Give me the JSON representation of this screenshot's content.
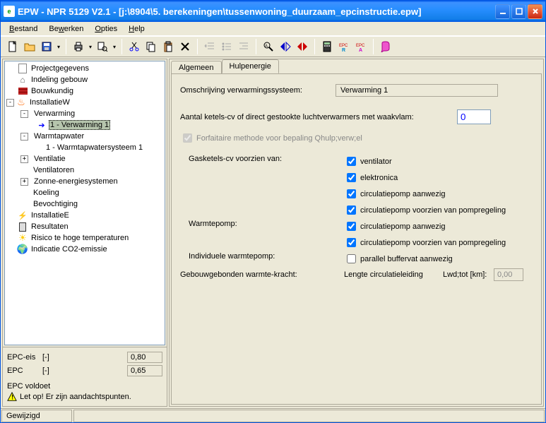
{
  "title": "EPW - NPR 5129 V2.1 - [j:\\8904\\5. berekeningen\\tussenwoning_duurzaam_epcinstructie.epw]",
  "menus": {
    "bestand": "Bestand",
    "bewerken": "Bewerken",
    "opties": "Opties",
    "help": "Help"
  },
  "tree": {
    "projectgegevens": "Projectgegevens",
    "indeling": "Indeling gebouw",
    "bouwkundig": "Bouwkundig",
    "installatiew": "InstallatieW",
    "verwarming": "Verwarming",
    "verwarming1": "1 - Verwarming 1",
    "warmtapwater": "Warmtapwater",
    "warmtap1": "1 - Warmtapwatersysteem 1",
    "ventilatie": "Ventilatie",
    "ventilatoren": "Ventilatoren",
    "zonne": "Zonne-energiesystemen",
    "koeling": "Koeling",
    "bevochtiging": "Bevochtiging",
    "installatiee": "InstallatieE",
    "resultaten": "Resultaten",
    "risico": "Risico te hoge temperaturen",
    "co2": "Indicatie CO2-emissie"
  },
  "bottom": {
    "epc_eis_label": "EPC-eis",
    "epc_eis_unit": "[-]",
    "epc_eis_val": "0,80",
    "epc_label": "EPC",
    "epc_unit": "[-]",
    "epc_val": "0,65",
    "status": "EPC voldoet",
    "warn": "Let op! Er zijn aandachtspunten."
  },
  "tabs": {
    "algemeen": "Algemeen",
    "hulpenergie": "Hulpenergie"
  },
  "form": {
    "omschrijving_label": "Omschrijving verwarmingssysteem:",
    "omschrijving_val": "Verwarming 1",
    "aantal_label": "Aantal ketels-cv of direct gestookte luchtverwarmers met waakvlam:",
    "aantal_val": "0",
    "forfaitaire": "Forfaitaire methode voor bepaling Qhulp;verw;el",
    "gasketels_label": "Gasketels-cv voorzien van:",
    "ventilator": "ventilator",
    "elektronica": "elektronica",
    "circ1": "circulatiepomp aanwezig",
    "circ2": "circulatiepomp voorzien van pompregeling",
    "warmtepomp_label": "Warmtepomp:",
    "circ3": "circulatiepomp aanwezig",
    "circ4": "circulatiepomp voorzien van pompregeling",
    "indiv_label": "Individuele warmtepomp:",
    "parallel": "parallel buffervat aanwezig",
    "gebouw_label": "Gebouwgebonden warmte-kracht:",
    "lengte_label": "Lengte circulatieleiding",
    "lwd_label": "Lwd;tot [km]:",
    "lwd_val": "0,00"
  },
  "status": {
    "gewijzigd": "Gewijzigd"
  }
}
